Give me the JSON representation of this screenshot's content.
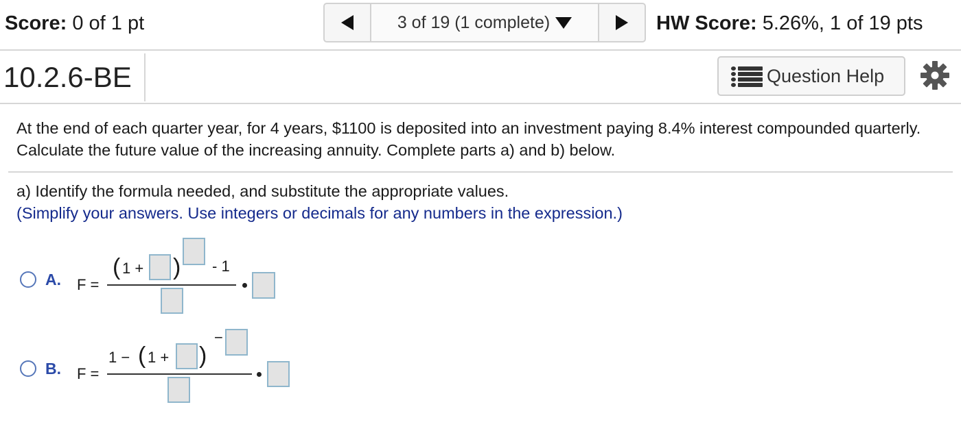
{
  "header": {
    "score_label": "Score:",
    "score_value": "0 of 1 pt",
    "nav_status": "3 of 19 (1 complete)",
    "hw_score_label": "HW Score:",
    "hw_score_value": "5.26%, 1 of 19 pts"
  },
  "question": {
    "id": "10.2.6-BE",
    "help_label": "Question Help",
    "prompt": "At the end of each quarter year, for 4 years, $1100 is deposited into an investment paying 8.4% interest compounded quarterly. Calculate the future value of the increasing annuity. Complete parts a) and b) below.",
    "part_a": "a) Identify the formula needed, and substitute the appropriate values.",
    "instruction": "(Simplify your answers. Use integers or decimals for any numbers in the expression.)"
  },
  "options": [
    {
      "letter": "A.",
      "lhs": "F =",
      "one_plus": "1 +",
      "minus_one": "- 1"
    },
    {
      "letter": "B.",
      "lhs": "F =",
      "one_minus": "1 −",
      "one_plus": "1 +",
      "neg_sign": "−"
    }
  ],
  "icons": {
    "prev": "triangle-left-icon",
    "next": "triangle-right-icon",
    "dropdown": "triangle-down-icon",
    "help": "list-icon",
    "settings": "gear-icon"
  },
  "colors": {
    "instruction_text": "#142a8c",
    "option_letter": "#2b4aa8",
    "radio_border": "#5576b9",
    "input_border": "#8fb6cc",
    "input_fill": "#e3e3e3"
  }
}
